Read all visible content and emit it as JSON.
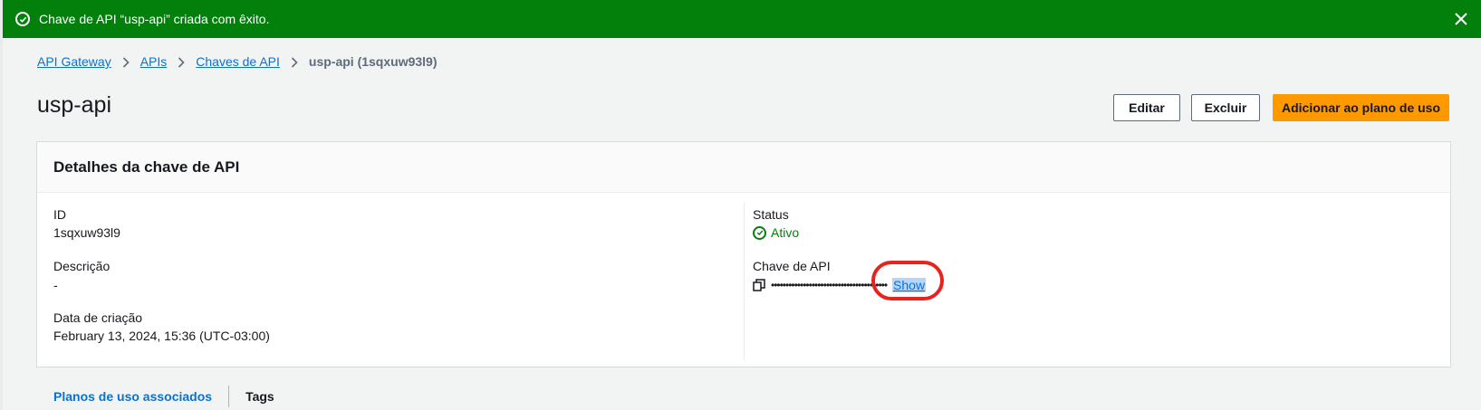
{
  "flash": {
    "message": "Chave de API “usp-api” criada com êxito.",
    "color": "#037f0c"
  },
  "breadcrumb": {
    "items": [
      "API Gateway",
      "APIs",
      "Chaves de API"
    ],
    "current": "usp-api (1sqxuw93l9)"
  },
  "page": {
    "title": "usp-api"
  },
  "actions": {
    "edit": "Editar",
    "delete": "Excluir",
    "add_plan": "Adicionar ao plano de uso",
    "primary_color": "#ff9900"
  },
  "details": {
    "heading": "Detalhes da chave de API",
    "id_label": "ID",
    "id_value": "1sqxuw93l9",
    "description_label": "Descrição",
    "description_value": "-",
    "created_label": "Data de criação",
    "created_value": "February 13, 2024, 15:36 (UTC-03:00)",
    "status_label": "Status",
    "status_value": "Ativo",
    "apikey_label": "Chave de API",
    "apikey_masked": "••••••••••••••••••••••••••••••••••••••••",
    "show_label": "Show"
  },
  "tabs": [
    "Planos de uso associados",
    "Tags"
  ]
}
